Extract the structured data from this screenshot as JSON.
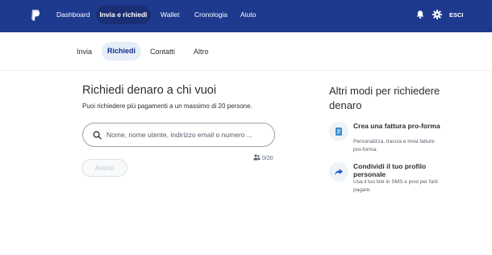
{
  "nav": {
    "items": [
      "Dashboard",
      "Invia e richiedi",
      "Wallet",
      "Cronologia",
      "Aiuto"
    ],
    "active_index": 1,
    "logout_label": "ESCI",
    "brand_color": "#1d3a8f"
  },
  "subnav": {
    "tabs": [
      "Invia",
      "Richiedi",
      "Contatti",
      "Altro"
    ],
    "active_index": 1
  },
  "request": {
    "title": "Richiedi denaro a chi vuoi",
    "subtitle": "Puoi richiedere più pagamenti a un massimo di 20 persone.",
    "search_placeholder": "Nome, nome utente, indirizzo email o numero ...",
    "counter": "0/20",
    "next_label": "Avanti"
  },
  "other_ways": {
    "title": "Altri modi per richiedere denaro",
    "options": [
      {
        "title": "Crea una fattura pro-forma",
        "description": "Personalizza, traccia e invia fatture pro-forma.",
        "icon": "invoice-icon"
      },
      {
        "title": "Condividi il tuo profilo personale",
        "description": "Usa il tuo link in SMS e post per farti pagare.",
        "icon": "share-icon"
      }
    ]
  }
}
